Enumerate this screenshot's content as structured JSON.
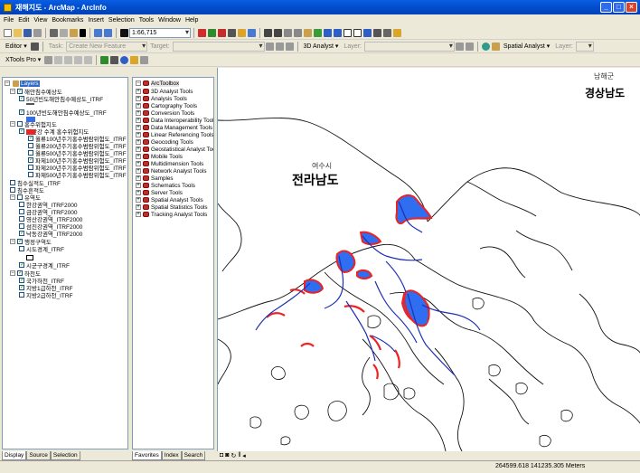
{
  "window": {
    "title": "재해지도 - ArcMap - ArcInfo",
    "buttons": {
      "minimize": "_",
      "maximize": "□",
      "close": "×"
    }
  },
  "menu": [
    "File",
    "Edit",
    "View",
    "Bookmarks",
    "Insert",
    "Selection",
    "Tools",
    "Window",
    "Help"
  ],
  "toolbar": {
    "scale": "1:66,715",
    "editor": "Editor ▾",
    "task_label": "Task:",
    "task_value": "Create New Feature",
    "target_label": "Target:",
    "analyst_3d": "3D Analyst ▾",
    "layer_label": "Layer:",
    "spatial_analyst": "Spatial Analyst ▾",
    "xtools": "XTools Pro ▾"
  },
  "toc": {
    "header": "Layers",
    "rows": [
      {
        "text": "해안침수예상도",
        "checked": true
      },
      {
        "text": "50년빈도해안침수예상도_ITRF",
        "checked": true
      },
      {
        "text": "100년빈도해안침수예상도_ITRF",
        "checked": true
      },
      {
        "text": "홍수위험지도",
        "checked": false
      },
      {
        "text": "영산강 수계 홍수위험지도",
        "checked": true
      },
      {
        "text": "월류100년주기홍수범람위험도_ITRF",
        "checked": true
      },
      {
        "text": "월류200년주기홍수범람위험도_ITRF",
        "checked": false
      },
      {
        "text": "월류500년주기홍수범람위험도_ITRF",
        "checked": false
      },
      {
        "text": "파제100년주기홍수범람위험도_ITRF",
        "checked": true
      },
      {
        "text": "파제200년주기홍수범람위험도_ITRF",
        "checked": false
      },
      {
        "text": "파제500년주기홍수범람위험도_ITRF",
        "checked": false
      },
      {
        "text": "침수실적도_ITRF",
        "checked": false
      },
      {
        "text": "침수흔적도",
        "checked": false
      },
      {
        "text": "유역도",
        "checked": false
      },
      {
        "text": "한강권역_ITRF2000",
        "checked": false
      },
      {
        "text": "금강권역_ITRF2000",
        "checked": false
      },
      {
        "text": "영산강권역_ITRF2000",
        "checked": false
      },
      {
        "text": "섬진강권역_ITRF2000",
        "checked": false
      },
      {
        "text": "낙동강권역_ITRF2000",
        "checked": true
      },
      {
        "text": "행정구역도",
        "checked": true
      },
      {
        "text": "시도경계_ITRF",
        "checked": false
      },
      {
        "text": "시군구경계_ITRF",
        "checked": true
      },
      {
        "text": "하천도",
        "checked": true
      },
      {
        "text": "국가하천_ITRF",
        "checked": true
      },
      {
        "text": "지방1급하천_ITRF",
        "checked": true
      },
      {
        "text": "지방2급하천_ITRF",
        "checked": false
      }
    ],
    "tabs": [
      "Display",
      "Source",
      "Selection"
    ]
  },
  "arctoolbox": {
    "header": "ArcToolbox",
    "items": [
      "3D Analyst Tools",
      "Analysis Tools",
      "Cartography Tools",
      "Conversion Tools",
      "Data Interoperability Tools",
      "Data Management Tools",
      "Linear Referencing Tools",
      "Geocoding Tools",
      "Geostatistical Analyst Tools",
      "Mobile Tools",
      "Multidimension Tools",
      "Network Analyst Tools",
      "Samples",
      "Schematics Tools",
      "Server Tools",
      "Spatial Analyst Tools",
      "Spatial Statistics Tools",
      "Tracking Analyst Tools"
    ],
    "tabs": [
      "Favorites",
      "Index",
      "Search"
    ]
  },
  "map": {
    "labels": {
      "namhae": "남해군",
      "gyeongnam": "경상남도",
      "yeosu": "여수시",
      "jeonnam": "전라남도"
    },
    "colors": {
      "flood_blue": "#2f6ef0",
      "flood_red": "#ee2222",
      "river": "#1d2fb5"
    }
  },
  "status": {
    "coords": "264599.618  141235.305 Meters"
  }
}
